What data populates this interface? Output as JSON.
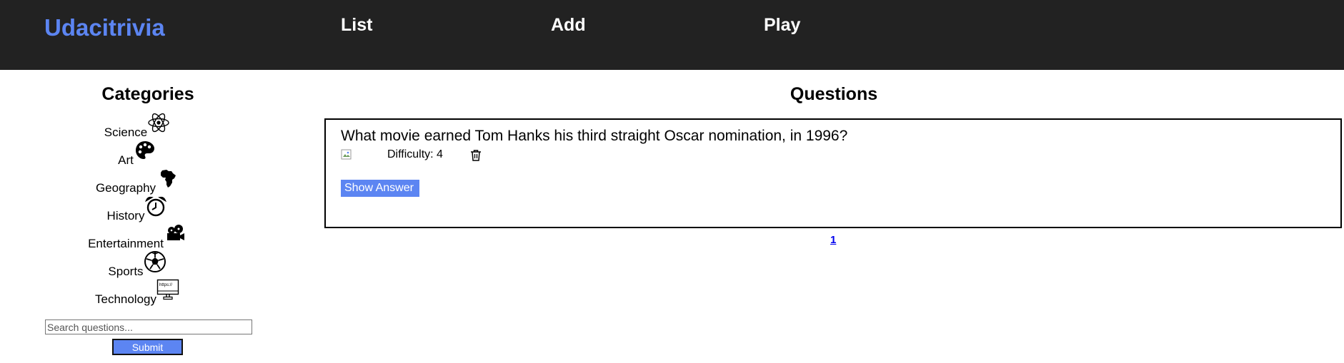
{
  "header": {
    "brand": "Udacitrivia",
    "nav": [
      {
        "label": "List"
      },
      {
        "label": "Add"
      },
      {
        "label": "Play"
      }
    ]
  },
  "sidebar": {
    "title": "Categories",
    "categories": [
      {
        "label": "Science",
        "icon": "atom-icon"
      },
      {
        "label": "Art",
        "icon": "palette-icon"
      },
      {
        "label": "Geography",
        "icon": "africa-icon"
      },
      {
        "label": "History",
        "icon": "alarm-clock-icon"
      },
      {
        "label": "Entertainment",
        "icon": "film-camera-icon"
      },
      {
        "label": "Sports",
        "icon": "soccer-ball-icon"
      },
      {
        "label": "Technology",
        "icon": "monitor-icon"
      }
    ],
    "technology_icon_text": "https://",
    "search_placeholder": "Search questions...",
    "submit_label": "Submit"
  },
  "main": {
    "title": "Questions",
    "questions": [
      {
        "text": "What movie earned Tom Hanks his third straight Oscar nomination, in 1996?",
        "difficulty": "Difficulty: 4",
        "show_answer_label": "Show Answer"
      }
    ],
    "pagination": [
      "1"
    ]
  },
  "colors": {
    "navbar_bg": "#222222",
    "brand": "#5c85f2",
    "button_bg": "#5c85f2",
    "link": "#0000ee"
  }
}
